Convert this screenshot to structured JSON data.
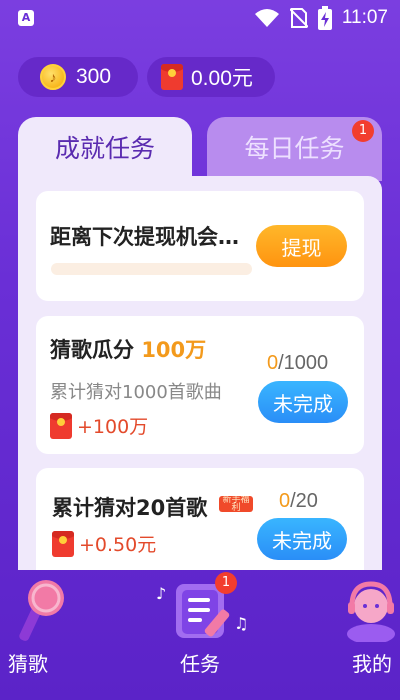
{
  "status_bar": {
    "app_icon_letter": "A",
    "time": "11:07"
  },
  "wallet": {
    "coins": "300",
    "cash": "0.00元"
  },
  "tabs": [
    {
      "label": "成就任务",
      "active": true
    },
    {
      "label": "每日任务",
      "active": false,
      "badge": "1"
    }
  ],
  "tasks": {
    "withdraw": {
      "title": "距离下次提现机会还差",
      "progress": 0,
      "button": "提现"
    },
    "guess_song": {
      "title_prefix": "猜歌瓜分",
      "title_highlight": "100万",
      "description": "累计猜对1000首歌曲",
      "reward": "+100万",
      "progress_done": "0",
      "progress_total": "/1000",
      "button": "未完成"
    },
    "guess_20": {
      "title": "累计猜对20首歌",
      "tag": "新手福利",
      "reward": "+0.50元",
      "progress_done": "0",
      "progress_total": "/20",
      "button": "未完成"
    }
  },
  "bottom_nav": [
    {
      "label": "猜歌",
      "icon": "microphone-icon"
    },
    {
      "label": "任务",
      "icon": "task-list-icon",
      "badge": "1"
    },
    {
      "label": "我的",
      "icon": "profile-avatar-icon"
    }
  ],
  "colors": {
    "background": "#6a2fd6",
    "panel": "#f0e9fb",
    "accent_orange": "#f39a1c",
    "button_blue": "#2a8ef7",
    "badge_red": "#f23d2e"
  }
}
